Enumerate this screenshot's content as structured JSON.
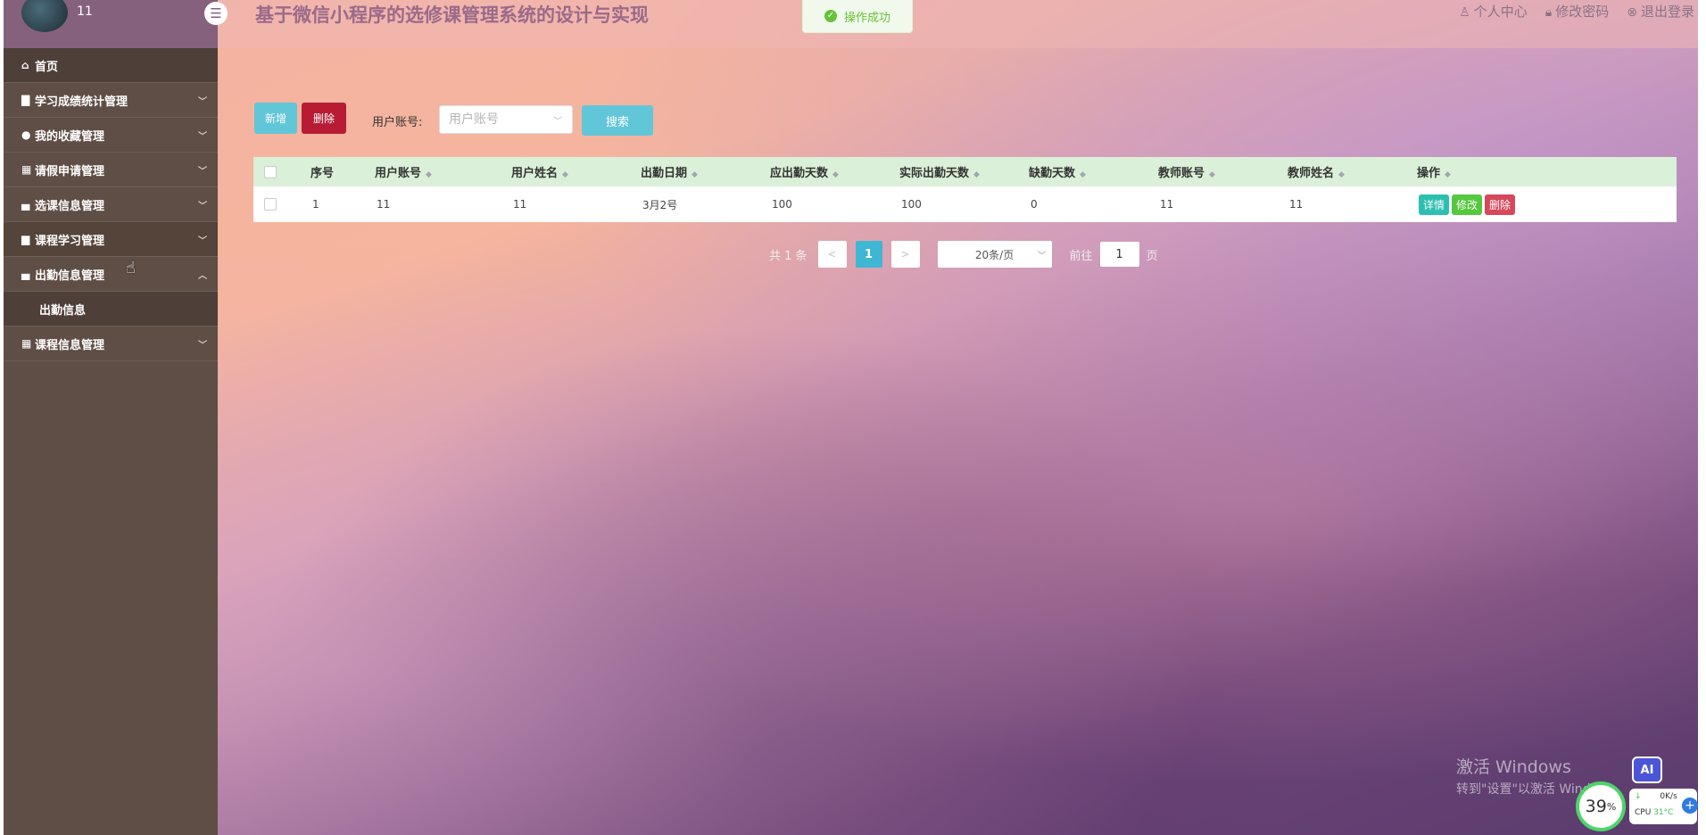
{
  "user": {
    "name": "11"
  },
  "header": {
    "title": "基于微信小程序的选修课管理系统的设计与实现",
    "links": [
      {
        "icon": "user-icon",
        "label": "个人中心"
      },
      {
        "icon": "lock-icon",
        "label": "修改密码"
      },
      {
        "icon": "logout-icon",
        "label": "退出登录"
      }
    ]
  },
  "toast": {
    "message": "操作成功"
  },
  "sidebar": {
    "items": [
      {
        "label": "首页",
        "icon": "home-icon"
      },
      {
        "label": "学习成绩统计管理",
        "icon": "file-icon"
      },
      {
        "label": "我的收藏管理",
        "icon": "star-icon"
      },
      {
        "label": "请假申请管理",
        "icon": "grid-icon"
      },
      {
        "label": "选课信息管理",
        "icon": "doc-icon"
      },
      {
        "label": "课程学习管理",
        "icon": "lock-icon"
      },
      {
        "label": "出勤信息管理",
        "icon": "doc-icon"
      },
      {
        "label": "出勤信息",
        "icon": ""
      },
      {
        "label": "课程信息管理",
        "icon": "grid-icon"
      }
    ]
  },
  "toolbar": {
    "add_label": "新增",
    "delete_label": "删除",
    "search_label": "用户账号:",
    "search_placeholder": "用户账号",
    "search_button": "搜索"
  },
  "table": {
    "columns": [
      "序号",
      "用户账号",
      "用户姓名",
      "出勤日期",
      "应出勤天数",
      "实际出勤天数",
      "缺勤天数",
      "教师账号",
      "教师姓名",
      "操作"
    ],
    "rows": [
      [
        "1",
        "11",
        "11",
        "3月2号",
        "100",
        "100",
        "0",
        "11",
        "11"
      ]
    ],
    "actions": {
      "detail": "详情",
      "edit": "修改",
      "delete": "删除"
    }
  },
  "pagination": {
    "total": "共 1 条",
    "prev": "<",
    "current": "1",
    "next": ">",
    "page_size": "20条/页",
    "goto_label": "前往",
    "goto_value": "1",
    "page_suffix": "页"
  },
  "watermark": {
    "line1": "激活 Windows",
    "line2": "转到\"设置\"以激活 Windows"
  },
  "tray": {
    "ai_label": "AI",
    "meter_value": "39",
    "meter_unit": "%",
    "net_speed": "0K/s",
    "cpu_label": "CPU",
    "cpu_temp": "31°C"
  },
  "colors": {
    "sidebar": "#5f4e45",
    "sidebar_head": "#86617d",
    "accent": "#62c6d9",
    "danger": "#b71c34",
    "table_head": "#daf0d8"
  }
}
